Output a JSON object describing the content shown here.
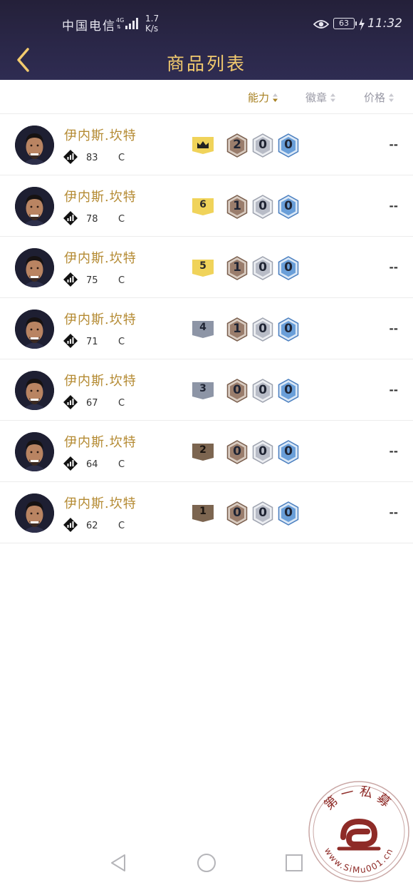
{
  "status_bar": {
    "carrier": "中国电信",
    "network": "4G",
    "speed_value": "1.7",
    "speed_unit": "K/s",
    "battery": "63",
    "time": "11:32",
    "icons": [
      "signal-icon",
      "eye-icon",
      "battery-icon",
      "charging-bolt-icon"
    ]
  },
  "header": {
    "back_icon": "chevron-left-icon",
    "title": "商品列表"
  },
  "sort": {
    "columns": [
      {
        "label": "能力",
        "active": true
      },
      {
        "label": "徽章",
        "active": false
      },
      {
        "label": "价格",
        "active": false
      }
    ]
  },
  "players": [
    {
      "name": "伊内斯.坎特",
      "ability": "83",
      "position": "C",
      "rank": "crown",
      "rank_label": "",
      "badges": [
        "2",
        "0",
        "0"
      ],
      "price": "--"
    },
    {
      "name": "伊内斯.坎特",
      "ability": "78",
      "position": "C",
      "rank": "6",
      "rank_label": "6",
      "badges": [
        "1",
        "0",
        "0"
      ],
      "price": "--"
    },
    {
      "name": "伊内斯.坎特",
      "ability": "75",
      "position": "C",
      "rank": "5",
      "rank_label": "5",
      "badges": [
        "1",
        "0",
        "0"
      ],
      "price": "--"
    },
    {
      "name": "伊内斯.坎特",
      "ability": "71",
      "position": "C",
      "rank": "4",
      "rank_label": "4",
      "badges": [
        "1",
        "0",
        "0"
      ],
      "price": "--"
    },
    {
      "name": "伊内斯.坎特",
      "ability": "67",
      "position": "C",
      "rank": "3",
      "rank_label": "3",
      "badges": [
        "0",
        "0",
        "0"
      ],
      "price": "--"
    },
    {
      "name": "伊内斯.坎特",
      "ability": "64",
      "position": "C",
      "rank": "2",
      "rank_label": "2",
      "badges": [
        "0",
        "0",
        "0"
      ],
      "price": "--"
    },
    {
      "name": "伊内斯.坎特",
      "ability": "62",
      "position": "C",
      "rank": "1",
      "rank_label": "1",
      "badges": [
        "0",
        "0",
        "0"
      ],
      "price": "--"
    }
  ],
  "nav_bar": {
    "buttons": [
      "nav-back-icon",
      "nav-home-icon",
      "nav-recent-icon"
    ]
  },
  "watermark": {
    "text": "第一私募",
    "url": "www.SiMu001.cn"
  },
  "colors": {
    "header_bg": "#2a2748",
    "title": "#f3cb6e",
    "name": "#b48a32",
    "sort_active": "#a78021",
    "sort_inactive": "#9a9aa6",
    "rank_gold": "#f0d35a",
    "rank_silver": "#8d95a6",
    "rank_bronze": "#7c6550",
    "badge_bronze": "#9a7d6c",
    "badge_silver": "#b8bcc7",
    "badge_blue": "#6a9fd9",
    "watermark": "#8e2b27"
  }
}
